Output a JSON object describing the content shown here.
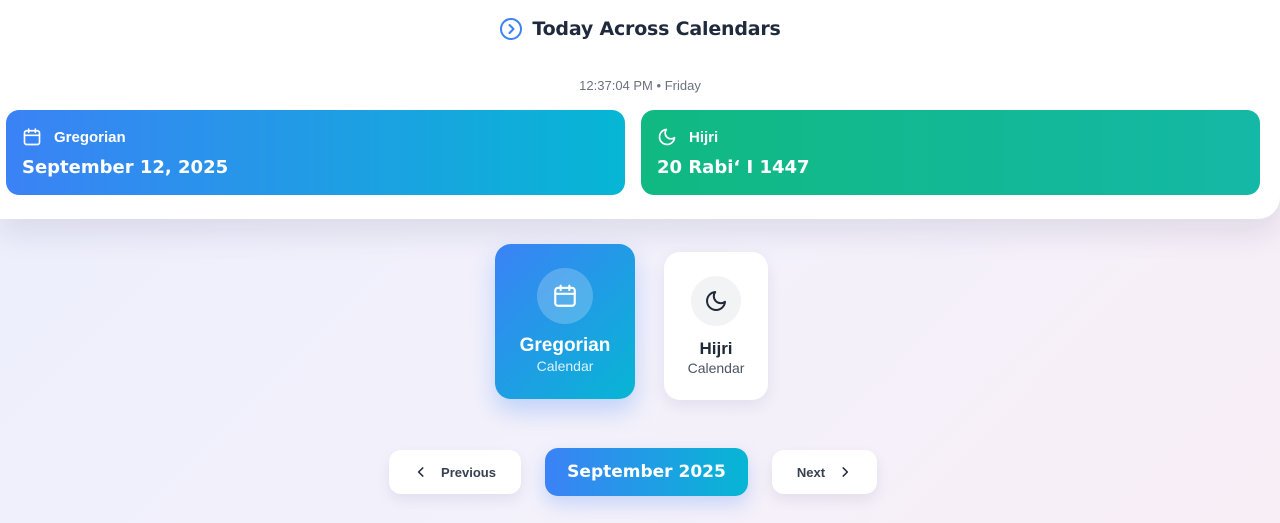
{
  "header": {
    "title": "Today Across Calendars",
    "time": "12:37:04 PM",
    "separator": "•",
    "weekday": "Friday",
    "title_icon": "chevron-circle-icon"
  },
  "today_cards": [
    {
      "label": "Gregorian",
      "date": "September 12, 2025",
      "icon": "calendar-icon"
    },
    {
      "label": "Hijri",
      "date": "20 Rabiʻ I 1447",
      "icon": "moon-icon"
    }
  ],
  "calendar_selector": {
    "selected": "Gregorian",
    "options": [
      {
        "name": "Gregorian",
        "sub": "Calendar",
        "icon": "calendar-icon"
      },
      {
        "name": "Hijri",
        "sub": "Calendar",
        "icon": "moon-icon"
      }
    ]
  },
  "navigation": {
    "previous_label": "Previous",
    "current_month": "September 2025",
    "next_label": "Next"
  },
  "colors": {
    "blue": "#3b82f6",
    "cyan": "#06b6d4",
    "green": "#10b981",
    "teal": "#14b8a6",
    "title_icon": "#3b82f6"
  }
}
